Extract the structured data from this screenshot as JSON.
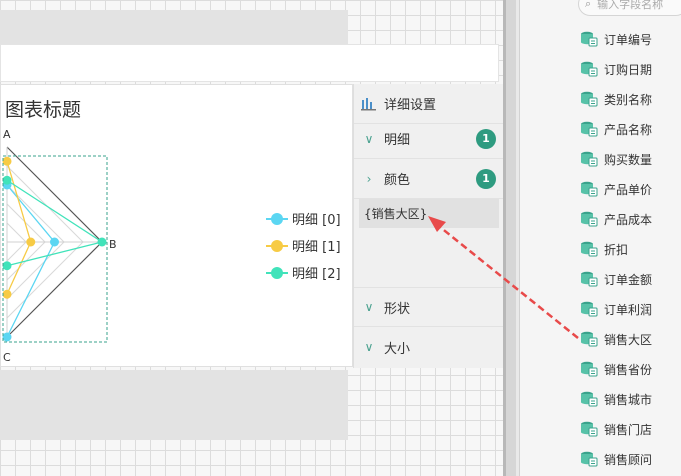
{
  "chart": {
    "title": "图表标题",
    "axes": [
      "A",
      "B",
      "C"
    ],
    "legend": [
      {
        "label": "明细 [0]",
        "color": "#5bd6f2"
      },
      {
        "label": "明细 [1]",
        "color": "#f7cb45"
      },
      {
        "label": "明细 [2]",
        "color": "#41e3ba"
      }
    ]
  },
  "chart_data": {
    "type": "radar",
    "title": "图表标题",
    "axes": [
      "A",
      "B",
      "C"
    ],
    "series": [
      {
        "name": "明细 [0]",
        "values": [
          0.6,
          0.5,
          1.0
        ]
      },
      {
        "name": "明细 [1]",
        "values": [
          0.85,
          0.25,
          0.55
        ]
      },
      {
        "name": "明细 [2]",
        "values": [
          0.65,
          1.0,
          0.25
        ]
      }
    ],
    "rlim": [
      0,
      1
    ],
    "grid": true,
    "legend_position": "right"
  },
  "props": {
    "settings_label": "详细设置",
    "detail_label": "明细",
    "detail_count": "1",
    "color_label": "颜色",
    "color_count": "1",
    "color_field": "{销售大区}",
    "shape_label": "形状",
    "size_label": "大小"
  },
  "fields": {
    "search_placeholder": "输入字段名称",
    "items": [
      "订单编号",
      "订购日期",
      "类别名称",
      "产品名称",
      "购买数量",
      "产品单价",
      "产品成本",
      "折扣",
      "订单金额",
      "订单利润",
      "销售大区",
      "销售省份",
      "销售城市",
      "销售门店",
      "销售顾问"
    ]
  },
  "colors": {
    "accent": "#2e9b80",
    "drag_arrow": "#e84a4a"
  }
}
